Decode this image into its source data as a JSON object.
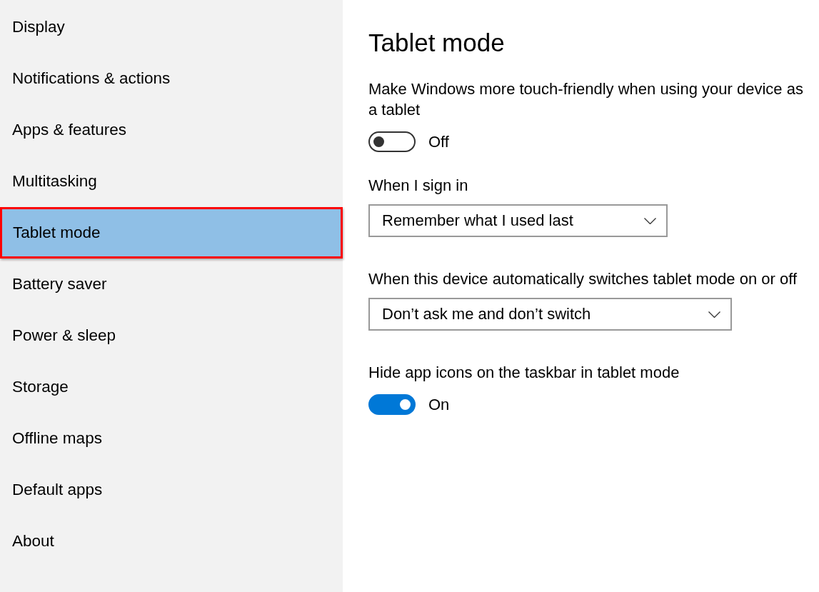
{
  "sidebar": {
    "items": [
      {
        "label": "Display",
        "selected": false
      },
      {
        "label": "Notifications & actions",
        "selected": false
      },
      {
        "label": "Apps & features",
        "selected": false
      },
      {
        "label": "Multitasking",
        "selected": false
      },
      {
        "label": "Tablet mode",
        "selected": true
      },
      {
        "label": "Battery saver",
        "selected": false
      },
      {
        "label": "Power & sleep",
        "selected": false
      },
      {
        "label": "Storage",
        "selected": false
      },
      {
        "label": "Offline maps",
        "selected": false
      },
      {
        "label": "Default apps",
        "selected": false
      },
      {
        "label": "About",
        "selected": false
      }
    ]
  },
  "page": {
    "title": "Tablet mode",
    "settings": [
      {
        "kind": "toggle",
        "label": "Make Windows more touch-friendly when using your device as a tablet",
        "on": false,
        "state_text": "Off"
      },
      {
        "kind": "dropdown",
        "label": "When I sign in",
        "value": "Remember what I used last"
      },
      {
        "kind": "dropdown",
        "label": "When this device automatically switches tablet mode on or off",
        "value": "Don’t ask me and don’t switch"
      },
      {
        "kind": "toggle",
        "label": "Hide app icons on the taskbar in tablet mode",
        "on": true,
        "state_text": "On"
      }
    ]
  }
}
